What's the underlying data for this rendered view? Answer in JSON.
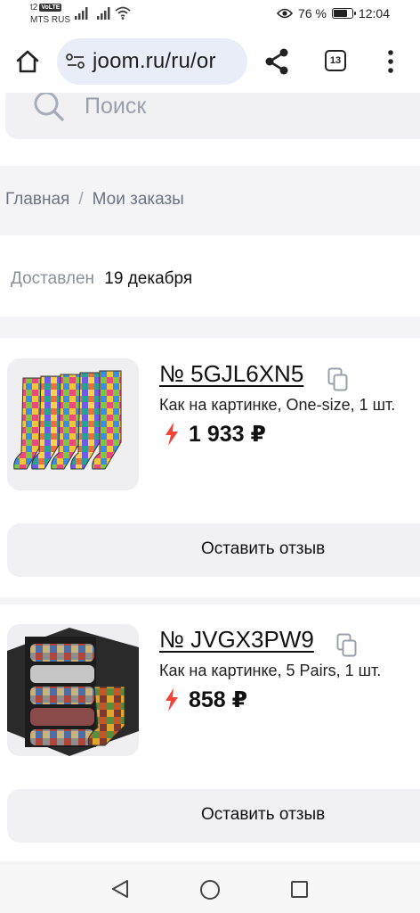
{
  "status_bar": {
    "network_type": "t2",
    "volte": "VoLTE",
    "carrier": "MTS RUS",
    "battery": "76 %",
    "battery_level": 0.76,
    "time": "12:04"
  },
  "browser": {
    "url": "joom.ru/ru/or",
    "tabs_count": "13",
    "icons": [
      "home-icon",
      "site-settings-icon",
      "share-icon",
      "tabs-icon",
      "more-icon"
    ]
  },
  "search": {
    "placeholder": "Поиск"
  },
  "breadcrumb": {
    "home": "Главная",
    "separator": "/",
    "current": "Мои заказы"
  },
  "delivery": {
    "label": "Доставлен",
    "date": "19 декабря"
  },
  "orders": [
    {
      "number": "№ 5GJL6XN5",
      "description": "Как на картинке, One-size, 1 шт.",
      "price": "1 933 ₽",
      "review_label": "Оставить отзыв"
    },
    {
      "number": "№ JVGX3PW9",
      "description": "Как на картинке, 5 Pairs, 1 шт.",
      "price": "858 ₽",
      "review_label": "Оставить отзыв"
    }
  ],
  "colors": {
    "lightning": "#f04438",
    "surface": "#f1f1f4",
    "url_bar": "#e8edf7"
  }
}
